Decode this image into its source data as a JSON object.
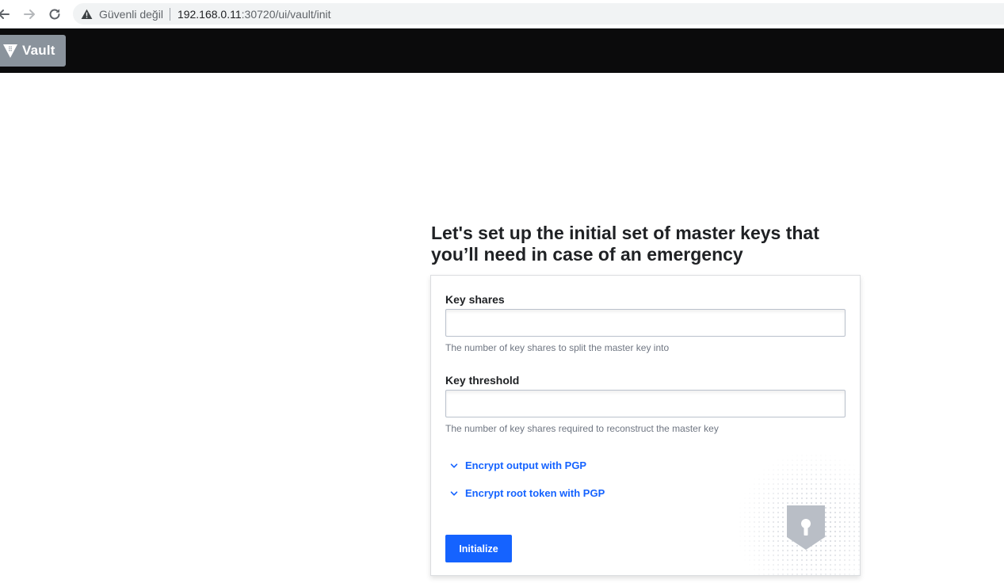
{
  "browser": {
    "security_label": "Güvenli değil",
    "url_host": "192.168.0.11",
    "url_path": ":30720/ui/vault/init"
  },
  "header": {
    "logo_text": "Vault",
    "logo_icon": "vault-triangle-icon"
  },
  "init": {
    "title": "Let's set up the initial set of master keys that you’ll need in case of an emergency",
    "key_shares": {
      "label": "Key shares",
      "value": "",
      "help": "The number of key shares to split the master key into"
    },
    "key_threshold": {
      "label": "Key threshold",
      "value": "",
      "help": "The number of key shares required to reconstruct the master key"
    },
    "toggles": [
      {
        "label": "Encrypt output with PGP",
        "icon": "chevron-down-icon"
      },
      {
        "label": "Encrypt root token with PGP",
        "icon": "chevron-down-icon"
      }
    ],
    "submit_label": "Initialize",
    "decor_icon": "shield-keyhole-icon"
  },
  "colors": {
    "accent": "#1563ff",
    "header_bg": "#0b0b0c",
    "logo_bg": "#8a939c"
  }
}
